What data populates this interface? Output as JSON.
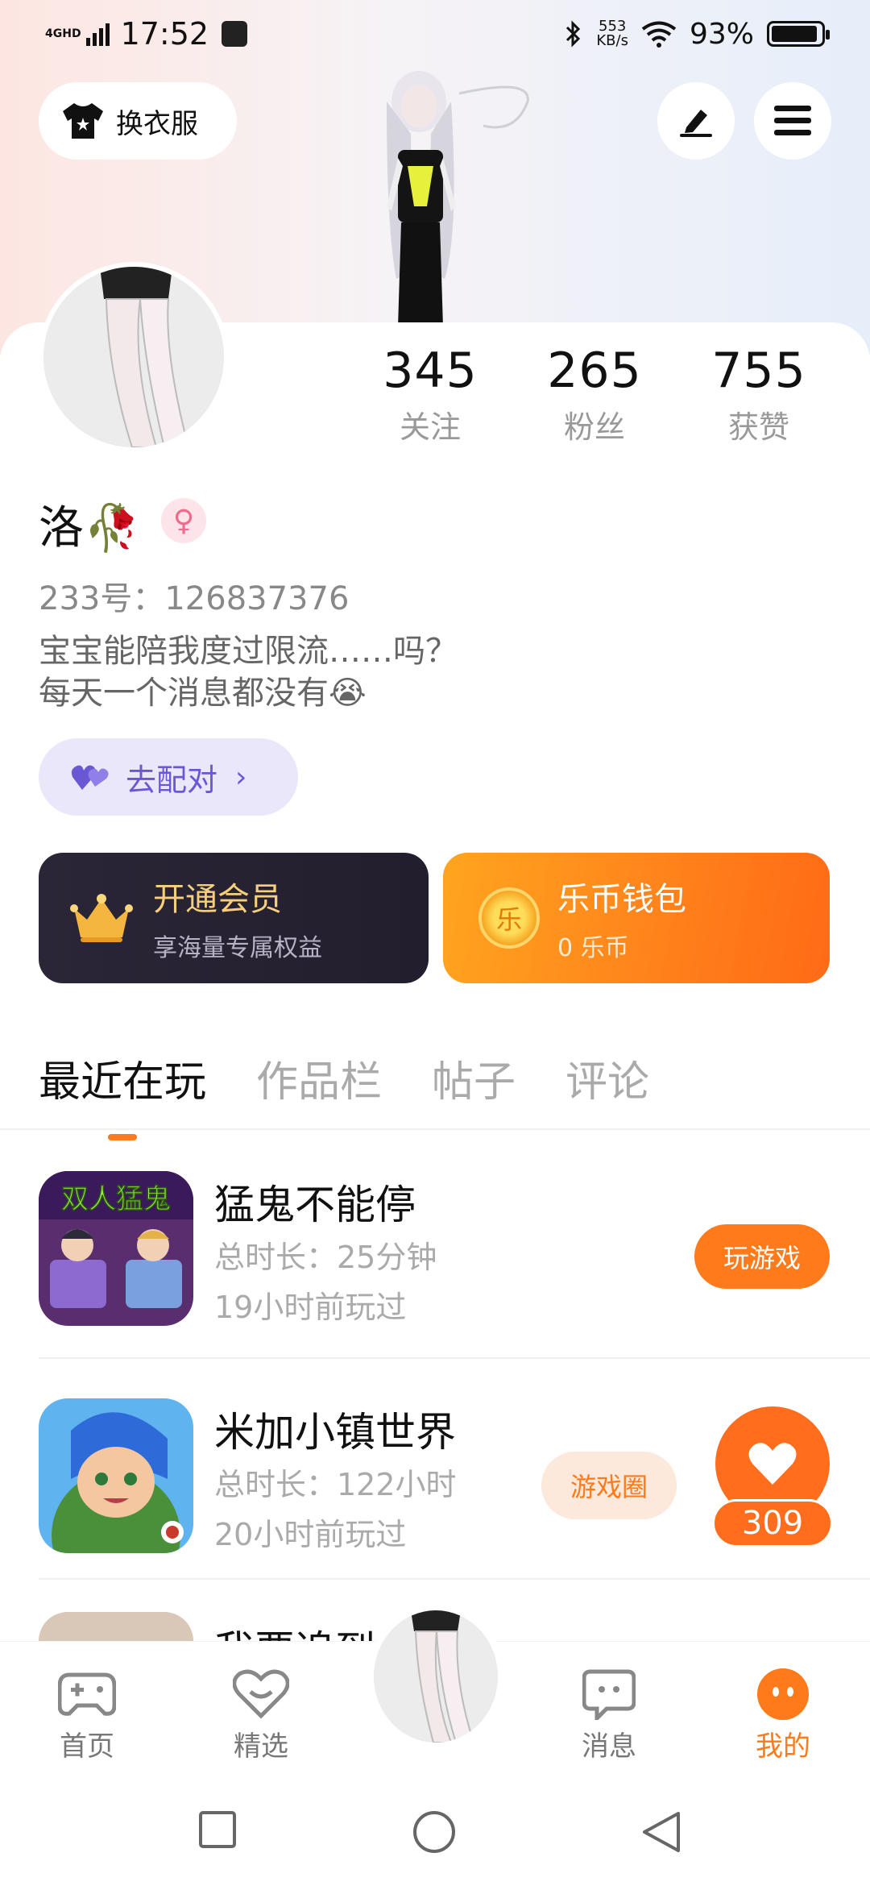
{
  "status_bar": {
    "network": "4GHD",
    "time": "17:52",
    "speed_value": "553",
    "speed_unit": "KB/s",
    "battery_percent": "93%",
    "battery_level": 0.93
  },
  "header": {
    "outfit_label": "换衣服"
  },
  "profile": {
    "stats": [
      {
        "value": "345",
        "label": "关注"
      },
      {
        "value": "265",
        "label": "粉丝"
      },
      {
        "value": "755",
        "label": "获赞"
      }
    ],
    "nickname": "洛🥀",
    "gender_symbol": "♀",
    "uid": "233号：126837376",
    "bio_line1": "宝宝能陪我度过限流……吗？",
    "bio_line2": "每天一个消息都没有😭",
    "match_label": "去配对",
    "match_arrow": "›"
  },
  "cards": {
    "vip_title": "开通会员",
    "vip_sub": "享海量专属权益",
    "wallet_title": "乐币钱包",
    "wallet_sub": "0 乐币",
    "coin_char": "乐"
  },
  "tabs": [
    "最近在玩",
    "作品栏",
    "帖子",
    "评论"
  ],
  "games": [
    {
      "name": "猛鬼不能停",
      "duration": "总时长：25分钟",
      "last_played": "19小时前玩过",
      "button": "玩游戏",
      "icon_text": "双人猛鬼"
    },
    {
      "name": "米加小镇世界",
      "duration": "总时长：122小时",
      "last_played": "20小时前玩过",
      "button": "游戏圈"
    },
    {
      "name": "我要追到"
    }
  ],
  "like_count": "309",
  "bottom_nav": [
    {
      "label": "首页"
    },
    {
      "label": "精选"
    },
    {
      "label": "消息"
    },
    {
      "label": "我的"
    }
  ],
  "colors": {
    "accent": "#ff7a1a",
    "vip_gold": "#f7cf7c",
    "match_purple": "#6a57d6"
  }
}
